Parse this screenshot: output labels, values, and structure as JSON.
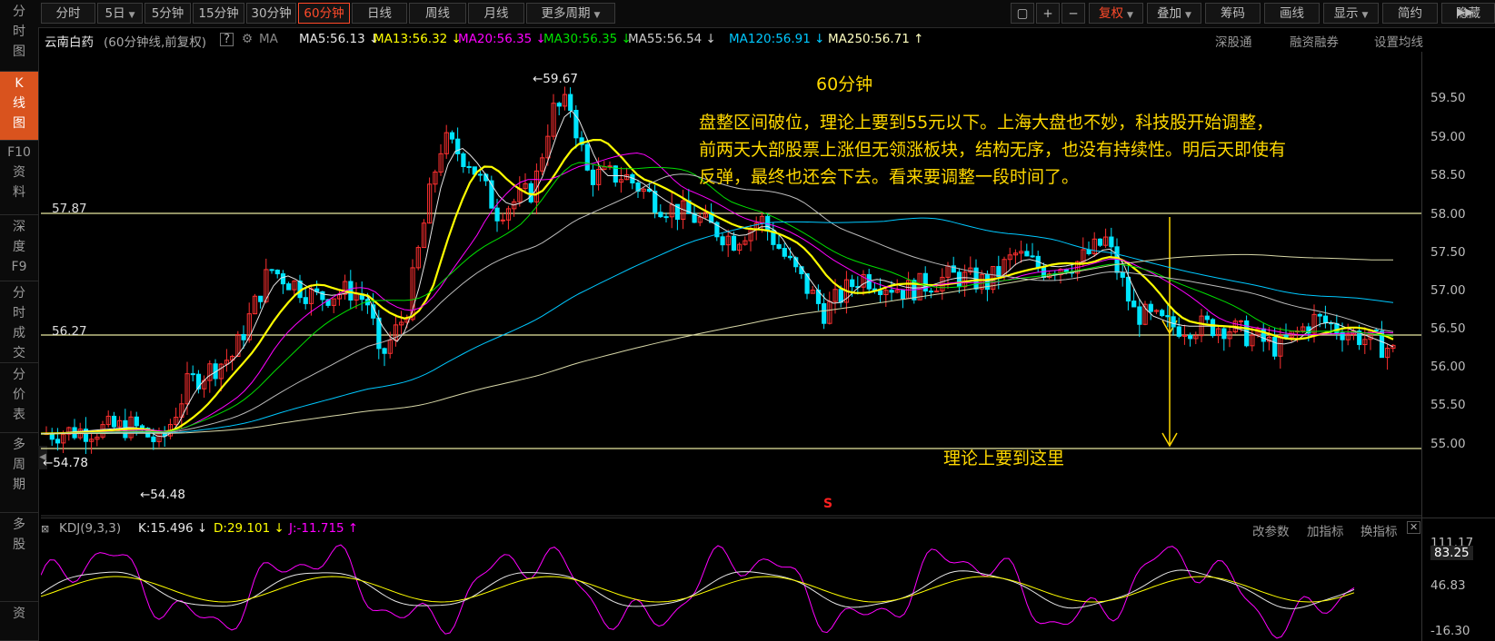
{
  "sidebar": {
    "items": [
      {
        "label": [
          "分",
          "时",
          "图"
        ]
      },
      {
        "label": [
          "K",
          "线",
          "图"
        ]
      },
      {
        "label": [
          "F10",
          "资",
          "料"
        ]
      },
      {
        "label": [
          "深",
          "度",
          "F9"
        ]
      },
      {
        "label": [
          "分",
          "时",
          "成",
          "交"
        ]
      },
      {
        "label": [
          "分",
          "价",
          "表"
        ]
      },
      {
        "label": [
          "多",
          "周",
          "期"
        ]
      },
      {
        "label": [
          "多",
          "股"
        ]
      },
      {
        "label": [
          "资"
        ]
      }
    ]
  },
  "toolbar": {
    "periods": [
      "分时",
      "5日",
      "5分钟",
      "15分钟",
      "30分钟",
      "60分钟",
      "日线",
      "周线",
      "月线",
      "更多周期"
    ],
    "active_period": "60分钟",
    "plus": "+",
    "minus": "−",
    "fuquan": "复权",
    "diejia": "叠加",
    "chouma": "筹码",
    "huaxian": "画线",
    "xianshi": "显示",
    "jianyue": "简约",
    "yincang": "隐藏"
  },
  "info": {
    "stock_name": "云南白药",
    "chart_type": "(60分钟线,前复权)",
    "help": "?",
    "ma_label": "MA",
    "ma": [
      {
        "text": "MA5:56.13 ↓",
        "color": "#e6e6e6"
      },
      {
        "text": "MA13:56.32 ↓",
        "color": "#ffff00"
      },
      {
        "text": "MA20:56.35 ↓",
        "color": "#ff00ff"
      },
      {
        "text": "MA30:56.35 ↓",
        "color": "#00e000"
      },
      {
        "text": "MA55:56.54 ↓",
        "color": "#cccccc"
      },
      {
        "text": "MA120:56.91 ↓",
        "color": "#00c8ff"
      },
      {
        "text": "MA250:56.71 ↑",
        "color": "#ffffc0"
      }
    ],
    "links": [
      "深股通",
      "融资融券",
      "设置均线"
    ]
  },
  "chart": {
    "title": "60分钟",
    "note_lines": [
      "盘整区间破位，理论上要到55元以下。上海大盘也不妙，科技股开始调整，",
      "前两天大部股票上涨但无领涨板块，结构无序，也没有持续性。明后天即使有",
      "反弹，最终也还会下去。看来要调整一段时间了。"
    ],
    "target_text": "理论上要到这里",
    "hline_upper": "57.87",
    "hline_lower": "56.27",
    "high_marker": "←59.67",
    "low_marker": "←54.48",
    "left_price": "←54.78",
    "s_mark": "S",
    "y_ticks": [
      "59.50",
      "59.00",
      "58.50",
      "58.00",
      "57.50",
      "57.00",
      "56.50",
      "56.00",
      "55.50",
      "55.00"
    ],
    "up_color": "#ff3030",
    "down_color": "#00e5ff",
    "annot_color": "#ffd800"
  },
  "kdj": {
    "label": "KDJ(9,3,3)",
    "k": "K:15.496 ↓",
    "d": "D:29.101 ↓",
    "j": "J:-11.715 ↑",
    "links": [
      "改参数",
      "加指标",
      "换指标"
    ],
    "close": "✕",
    "axis": [
      "111.17",
      "83.25",
      "46.83",
      "-16.30"
    ]
  }
}
